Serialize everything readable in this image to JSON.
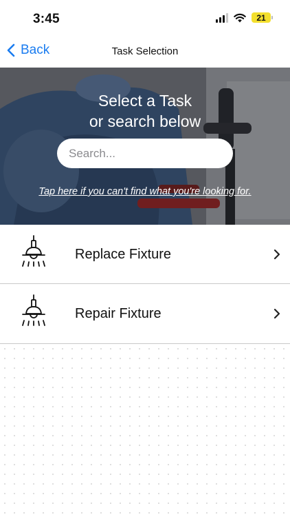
{
  "status_bar": {
    "time": "3:45",
    "battery_level": "21",
    "battery_color": "#f3df2e",
    "icons": [
      "signal-icon",
      "wifi-icon",
      "battery-icon"
    ]
  },
  "nav": {
    "back_label": "Back",
    "title": "Task Selection",
    "accent_color": "#1a7cf0"
  },
  "hero": {
    "title_line1": "Select a Task",
    "title_line2": "or search below",
    "search_placeholder": "Search...",
    "search_value": "",
    "help_link": "Tap here if you can't find what you're looking for."
  },
  "tasks": [
    {
      "label": "Replace Fixture",
      "icon": "light-fixture-icon"
    },
    {
      "label": "Repair Fixture",
      "icon": "light-fixture-icon"
    }
  ]
}
